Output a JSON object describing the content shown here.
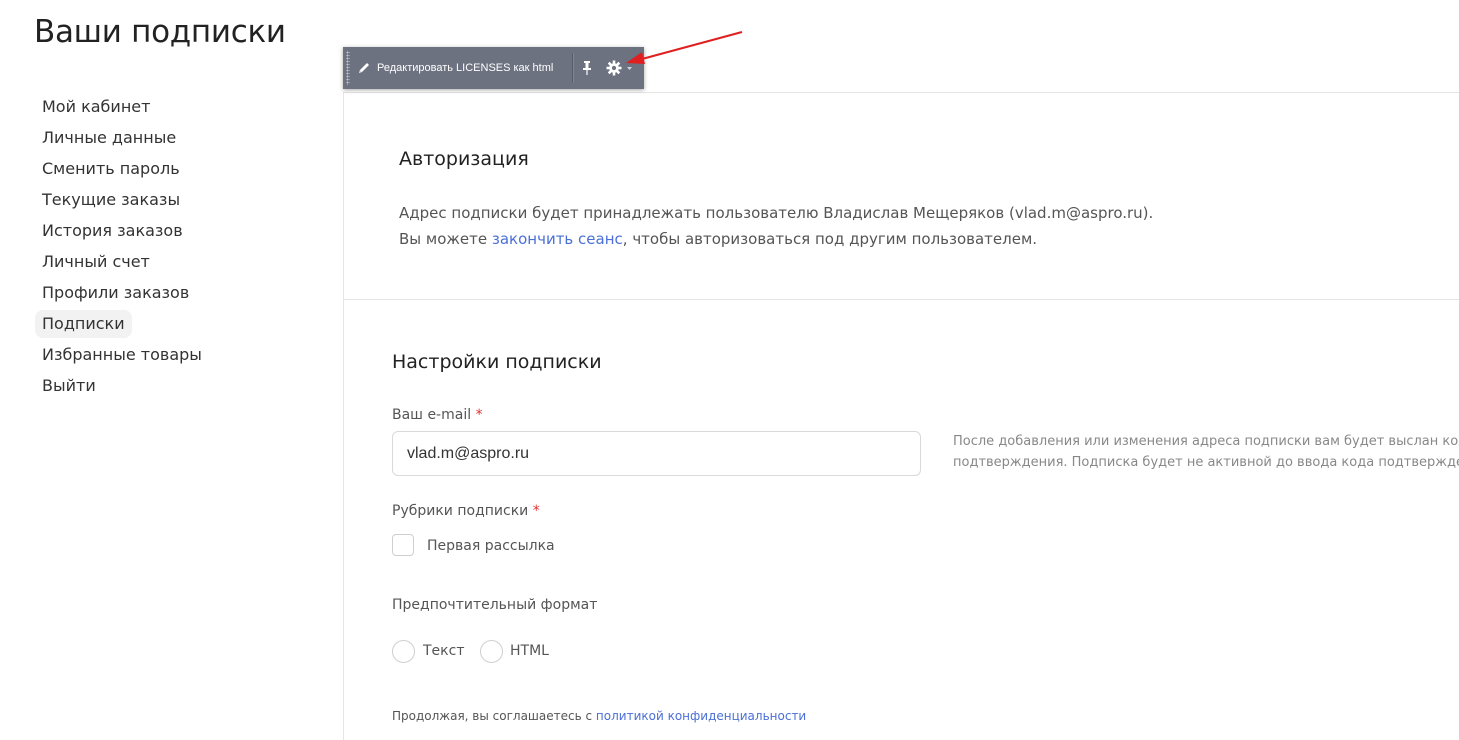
{
  "page": {
    "title": "Ваши подписки"
  },
  "sidebar": {
    "items": [
      {
        "label": "Мой кабинет"
      },
      {
        "label": "Личные данные"
      },
      {
        "label": "Сменить пароль"
      },
      {
        "label": "Текущие заказы"
      },
      {
        "label": "История заказов"
      },
      {
        "label": "Личный счет"
      },
      {
        "label": "Профили заказов"
      },
      {
        "label": "Подписки",
        "active": true
      },
      {
        "label": "Избранные товары"
      },
      {
        "label": "Выйти"
      }
    ]
  },
  "toolbar": {
    "edit_label": "Редактировать LICENSES как html",
    "icons": [
      "pencil-icon",
      "pin-icon",
      "gear-icon",
      "caret-down-icon"
    ]
  },
  "auth": {
    "title": "Авторизация",
    "line1": "Адрес подписки будет принадлежать пользователю Владислав Мещеряков (vlad.m@aspro.ru).",
    "line2_prefix": "Вы можете ",
    "line2_link": "закончить сеанс",
    "line2_suffix": ", чтобы авторизоваться под другим пользователем."
  },
  "settings": {
    "title": "Настройки подписки",
    "email_label": "Ваш e-mail",
    "required_mark": "*",
    "email_value": "vlad.m@aspro.ru",
    "hint_line1": "После добавления или изменения адреса подписки вам будет выслан код",
    "hint_line2": "подтверждения. Подписка будет не активной до ввода кода подтверждения.",
    "rubrics_label": "Рубрики подписки",
    "rubric_option": "Первая рассылка",
    "format_label": "Предпочтительный формат",
    "format_text": "Текст",
    "format_html": "HTML",
    "policy_prefix": "Продолжая, вы соглашаетесь с ",
    "policy_link": "политикой конфиденциальности"
  },
  "colors": {
    "link": "#4a6fd6",
    "required": "#e03030",
    "toolbar_bg": "#6c7280",
    "annotation_arrow": "#e02020"
  }
}
